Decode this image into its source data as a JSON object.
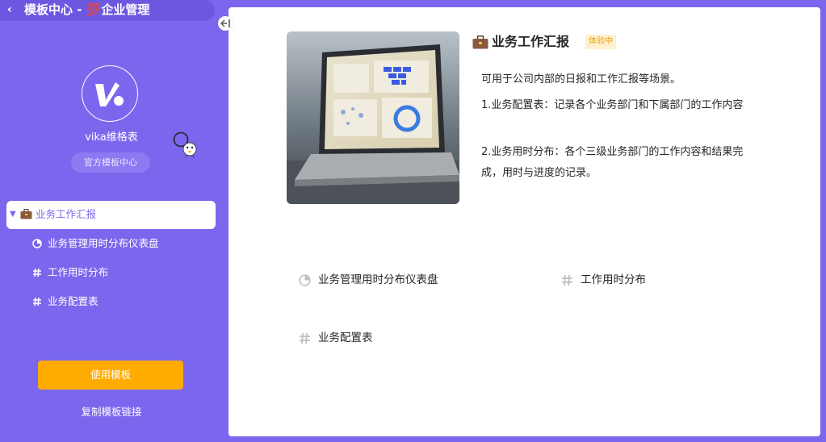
{
  "header": {
    "title": "模板中心 - 💯企业管理"
  },
  "sidebar": {
    "org_name": "vika维格表",
    "official_badge": "官方模板中心",
    "tree": {
      "active_label": "业务工作汇报",
      "children": [
        {
          "label": "业务管理用时分布仪表盘",
          "icon": "dashboard-icon"
        },
        {
          "label": "工作用时分布",
          "icon": "grid-icon"
        },
        {
          "label": "业务配置表",
          "icon": "grid-icon"
        }
      ]
    },
    "use_button": "使用模板",
    "copy_link": "复制模板链接"
  },
  "template": {
    "title": "业务工作汇报",
    "badge": "体验中",
    "desc": [
      "可用于公司内部的日报和工作汇报等场景。",
      "1.业务配置表：记录各个业务部门和下属部门的工作内容",
      "2.业务用时分布：各个三级业务部门的工作内容和结果完成，用时与进度的记录。"
    ],
    "nodes": [
      {
        "label": "业务管理用时分布仪表盘",
        "icon": "dashboard-icon"
      },
      {
        "label": "工作用时分布",
        "icon": "grid-icon"
      },
      {
        "label": "业务配置表",
        "icon": "grid-icon"
      }
    ]
  },
  "colors": {
    "primary": "#7b67ee",
    "accent": "#ffab00",
    "badge_bg": "#fff1cf",
    "badge_text": "#f0a000"
  }
}
